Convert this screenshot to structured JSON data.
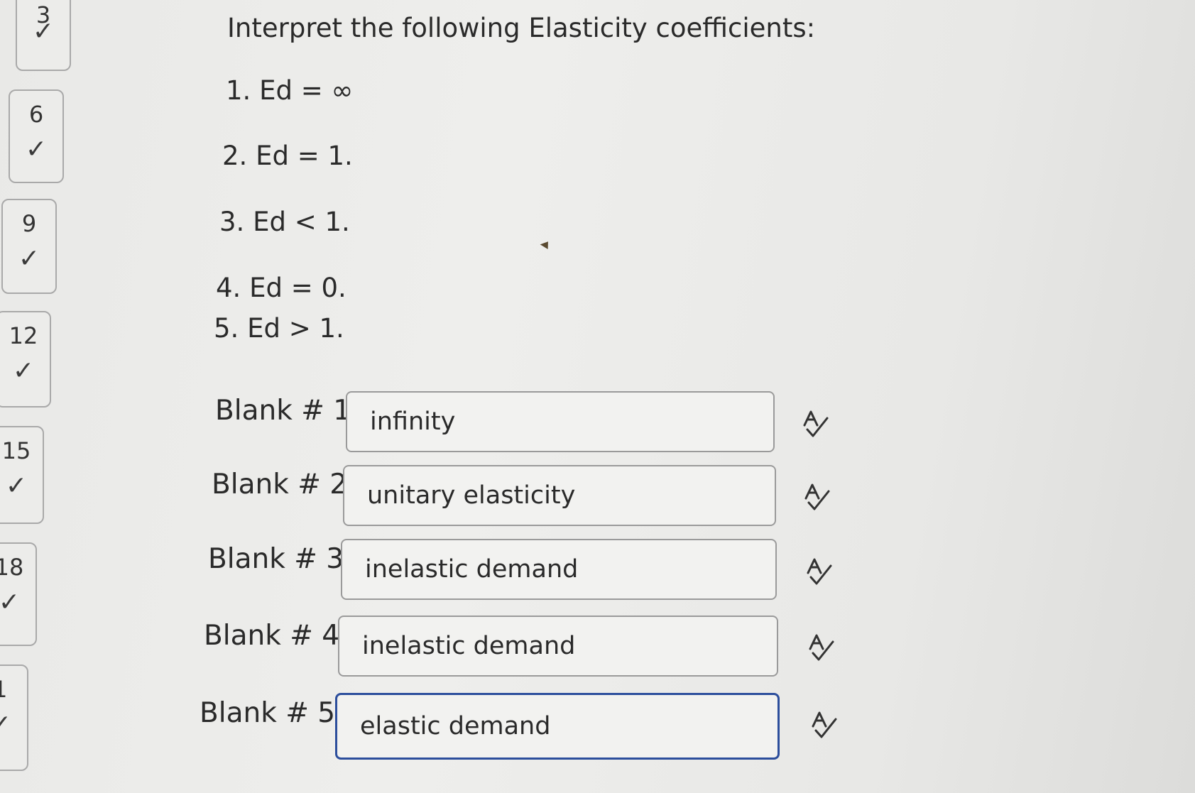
{
  "navigator": [
    {
      "number": "3",
      "status": "answered"
    },
    {
      "number": "6",
      "status": "answered"
    },
    {
      "number": "9",
      "status": "answered"
    },
    {
      "number": "12",
      "status": "answered"
    },
    {
      "number": "15",
      "status": "answered"
    },
    {
      "number": "18",
      "status": "answered"
    },
    {
      "number": "1",
      "status": "answered"
    }
  ],
  "check_glyph": "✓",
  "question": {
    "title": "Interpret the following Elasticity coefficients:",
    "items": [
      "1. Ed = ∞",
      "2. Ed = 1.",
      "3. Ed < 1.",
      "4. Ed = 0.",
      "5. Ed > 1."
    ]
  },
  "blanks": [
    {
      "label": "Blank # 1",
      "value": "infinity"
    },
    {
      "label": "Blank # 2",
      "value": "unitary elasticity"
    },
    {
      "label": "Blank # 3",
      "value": "inelastic demand"
    },
    {
      "label": "Blank # 4",
      "value": "inelastic demand"
    },
    {
      "label": "Blank # 5",
      "value": "elastic demand",
      "focused": true
    }
  ],
  "icons": {
    "spellcheck": "spellcheck-icon"
  },
  "colors": {
    "focus_border": "#2c4e9c",
    "input_border": "#9a9a9a"
  }
}
